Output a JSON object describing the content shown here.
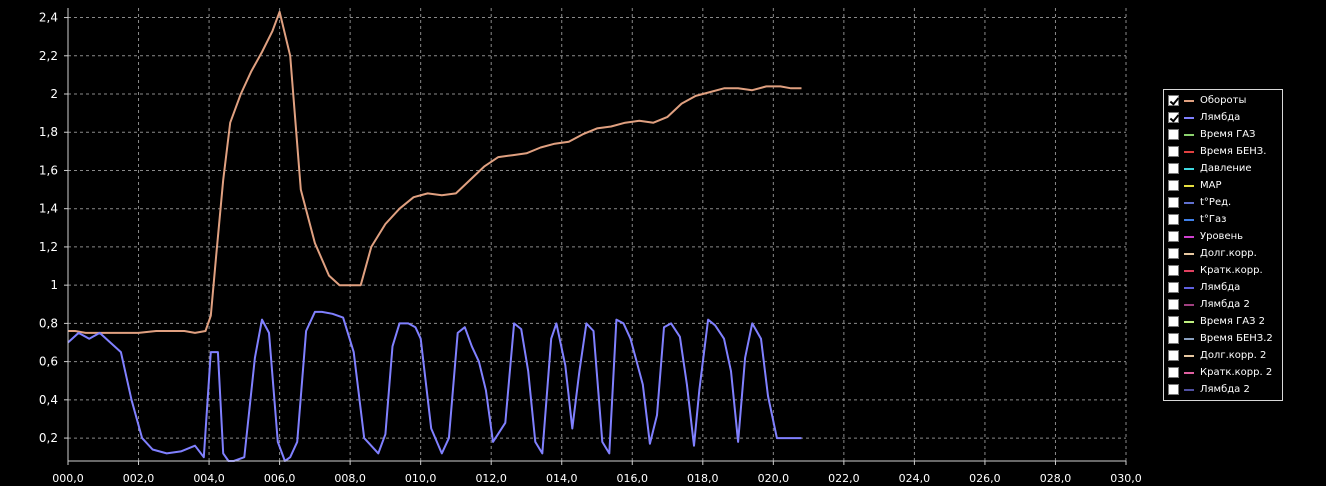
{
  "chart_data": {
    "type": "line",
    "title": "",
    "xlabel": "",
    "ylabel": "",
    "xlim": [
      0,
      30
    ],
    "ylim": [
      0.08,
      2.45
    ],
    "grid": true,
    "legend_position": "right",
    "x_ticks": [
      "000,0",
      "002,0",
      "004,0",
      "006,0",
      "008,0",
      "010,0",
      "012,0",
      "014,0",
      "016,0",
      "018,0",
      "020,0",
      "022,0",
      "024,0",
      "026,0",
      "028,0",
      "030,0"
    ],
    "y_ticks": [
      "0,2",
      "0,4",
      "0,6",
      "0,8",
      "1",
      "1,2",
      "1,4",
      "1,6",
      "1,8",
      "2",
      "2,2",
      "2,4"
    ],
    "y_tick_values": [
      0.2,
      0.4,
      0.6,
      0.8,
      1.0,
      1.2,
      1.4,
      1.6,
      1.8,
      2.0,
      2.2,
      2.4
    ],
    "series": [
      {
        "name": "Обороты",
        "color": "#e0a080",
        "x": [
          0,
          0.2,
          0.5,
          1.0,
          1.5,
          2.0,
          2.5,
          3.0,
          3.3,
          3.6,
          3.9,
          4.05,
          4.2,
          4.4,
          4.6,
          4.9,
          5.2,
          5.5,
          5.8,
          6.0,
          6.3,
          6.6,
          7.0,
          7.4,
          7.7,
          8.0,
          8.3,
          8.6,
          9.0,
          9.4,
          9.8,
          10.2,
          10.6,
          11.0,
          11.4,
          11.8,
          12.2,
          12.6,
          13.0,
          13.4,
          13.8,
          14.2,
          14.6,
          15.0,
          15.4,
          15.8,
          16.2,
          16.6,
          17.0,
          17.4,
          17.8,
          18.2,
          18.6,
          19.0,
          19.4,
          19.8,
          20.2,
          20.5,
          20.8
        ],
        "values": [
          0.76,
          0.76,
          0.75,
          0.75,
          0.75,
          0.75,
          0.76,
          0.76,
          0.76,
          0.75,
          0.76,
          0.84,
          1.15,
          1.55,
          1.85,
          2.0,
          2.12,
          2.22,
          2.33,
          2.43,
          2.2,
          1.5,
          1.22,
          1.05,
          1.0,
          1.0,
          1.0,
          1.2,
          1.32,
          1.4,
          1.46,
          1.48,
          1.47,
          1.48,
          1.55,
          1.62,
          1.67,
          1.68,
          1.69,
          1.72,
          1.74,
          1.75,
          1.79,
          1.82,
          1.83,
          1.85,
          1.86,
          1.85,
          1.88,
          1.95,
          1.99,
          2.01,
          2.03,
          2.03,
          2.02,
          2.04,
          2.04,
          2.03,
          2.03
        ],
        "checked": true
      },
      {
        "name": "Лямбда",
        "color": "#8080ff",
        "x": [
          0,
          0.3,
          0.6,
          0.9,
          1.2,
          1.5,
          1.8,
          2.1,
          2.4,
          2.8,
          3.2,
          3.6,
          3.85,
          4.05,
          4.25,
          4.4,
          4.55,
          4.7,
          5.0,
          5.3,
          5.5,
          5.7,
          5.95,
          6.15,
          6.3,
          6.5,
          6.75,
          7.0,
          7.2,
          7.5,
          7.8,
          8.1,
          8.4,
          8.8,
          9.0,
          9.2,
          9.4,
          9.65,
          9.85,
          10.0,
          10.3,
          10.6,
          10.8,
          11.05,
          11.25,
          11.45,
          11.65,
          11.85,
          12.05,
          12.4,
          12.65,
          12.85,
          13.05,
          13.25,
          13.45,
          13.7,
          13.85,
          14.1,
          14.3,
          14.5,
          14.7,
          14.9,
          15.15,
          15.35,
          15.55,
          15.75,
          15.95,
          16.3,
          16.5,
          16.7,
          16.9,
          17.1,
          17.35,
          17.55,
          17.75,
          17.9,
          18.15,
          18.35,
          18.6,
          18.8,
          19.0,
          19.2,
          19.4,
          19.65,
          19.85,
          20.1,
          20.4,
          20.6,
          20.8
        ],
        "values": [
          0.7,
          0.75,
          0.72,
          0.75,
          0.7,
          0.65,
          0.4,
          0.2,
          0.14,
          0.12,
          0.13,
          0.16,
          0.1,
          0.65,
          0.65,
          0.12,
          0.08,
          0.08,
          0.1,
          0.62,
          0.82,
          0.75,
          0.18,
          0.08,
          0.1,
          0.18,
          0.76,
          0.86,
          0.86,
          0.85,
          0.83,
          0.65,
          0.2,
          0.12,
          0.22,
          0.68,
          0.8,
          0.8,
          0.78,
          0.72,
          0.25,
          0.12,
          0.2,
          0.75,
          0.78,
          0.68,
          0.6,
          0.45,
          0.18,
          0.28,
          0.8,
          0.77,
          0.55,
          0.18,
          0.12,
          0.72,
          0.8,
          0.58,
          0.25,
          0.55,
          0.8,
          0.76,
          0.18,
          0.12,
          0.82,
          0.8,
          0.72,
          0.48,
          0.17,
          0.32,
          0.78,
          0.8,
          0.73,
          0.48,
          0.16,
          0.45,
          0.82,
          0.79,
          0.72,
          0.55,
          0.18,
          0.62,
          0.8,
          0.72,
          0.42,
          0.2,
          0.2,
          0.2,
          0.2
        ],
        "checked": true
      }
    ]
  },
  "legend": {
    "items": [
      {
        "label": "Обороты",
        "color": "#e0a080",
        "checked": true,
        "dashed": false
      },
      {
        "label": "Лямбда",
        "color": "#8080ff",
        "checked": true,
        "dashed": false
      },
      {
        "label": "Время ГАЗ",
        "color": "#8cd26e",
        "checked": false,
        "dashed": false
      },
      {
        "label": "Время БЕНЗ.",
        "color": "#e04040",
        "checked": false,
        "dashed": false
      },
      {
        "label": "Давление",
        "color": "#40d8e0",
        "checked": false,
        "dashed": false
      },
      {
        "label": "MAP",
        "color": "#e8e040",
        "checked": false,
        "dashed": false
      },
      {
        "label": "t°Ред.",
        "color": "#6070d0",
        "checked": false,
        "dashed": false
      },
      {
        "label": "t°Газ",
        "color": "#4080e8",
        "checked": false,
        "dashed": false
      },
      {
        "label": "Уровень",
        "color": "#d040d0",
        "checked": false,
        "dashed": false
      },
      {
        "label": "Долг.корр.",
        "color": "#e8c8a0",
        "checked": false,
        "dashed": true
      },
      {
        "label": "Кратк.корр.",
        "color": "#e04060",
        "checked": false,
        "dashed": true
      },
      {
        "label": "Лямбда",
        "color": "#6060e0",
        "checked": false,
        "dashed": false
      },
      {
        "label": "Лямбда 2",
        "color": "#a04080",
        "checked": false,
        "dashed": false
      },
      {
        "label": "Время ГАЗ 2",
        "color": "#c0f080",
        "checked": false,
        "dashed": false
      },
      {
        "label": "Время БЕНЗ.2",
        "color": "#8aa0c0",
        "checked": false,
        "dashed": false
      },
      {
        "label": "Долг.корр. 2",
        "color": "#e8c8a0",
        "checked": false,
        "dashed": true
      },
      {
        "label": "Кратк.корр. 2",
        "color": "#e060a0",
        "checked": false,
        "dashed": true
      },
      {
        "label": "Лямбда 2",
        "color": "#5050a0",
        "checked": false,
        "dashed": false
      }
    ]
  }
}
